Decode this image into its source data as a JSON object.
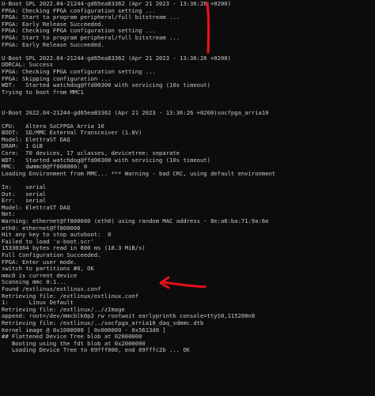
{
  "terminal": {
    "lines": [
      "U-Boot SPL 2022.04-21244-gd65ea83362 (Apr 21 2023 - 13:36:26 +0200)",
      "FPGA: Checking FPGA configuration setting ...",
      "FPGA: Start to program peripheral/full bitstream ...",
      "FPGA: Early Release Succeeded.",
      "FPGA: Checking FPGA configuration setting ...",
      "FPGA: Start to program peripheral/full bitstream ...",
      "FPGA: Early Release Succeeded.",
      "",
      "U-Boot SPL 2022.04-21244-gd65ea83362 (Apr 21 2023 - 13:36:26 +0200)",
      "DDRCAL: Success",
      "FPGA: Checking FPGA configuration setting ...",
      "FPGA: Skipping configuration ...",
      "WDT:   Started watchdog@ffd00300 with servicing (10s timeout)",
      "Trying to boot from MMC1",
      "",
      "",
      "U-Boot 2022.04-21244-gd65ea83362 (Apr 21 2023 - 13:36:26 +0200)socfpga_arria10",
      "",
      "CPU:   Altera SoCFPGA Arria 10",
      "BOOT:  SD/MMC External Transceiver (1.8V)",
      "Model: ElettraST DAQ",
      "DRAM:  1 GiB",
      "Core:  70 devices, 17 uclasses, devicetree: separate",
      "WDT:   Started watchdog@ffd00300 with servicing (10s timeout)",
      "MMC:   dwmmc0@ff808000: 0",
      "Loading Environment from MMC... *** Warning - bad CRC, using default environment",
      "",
      "In:    serial",
      "Out:   serial",
      "Err:   serial",
      "Model: ElettraST DAQ",
      "Net:",
      "Warning: ethernet@ff800000 (eth0) using random MAC address - 8e:a6:ba:71:9a:6e",
      "eth0: ethernet@ff800000",
      "Hit any key to stop autoboot:  0",
      "Failed to load 'u-boot.scr'",
      "15330364 bytes read in 800 ms (18.3 MiB/s)",
      "Full Configuration Succeeded.",
      "FPGA: Enter user mode.",
      "switch to partitions #0, OK",
      "mmc0 is current device",
      "Scanning mmc 0:1...",
      "Found /extlinux/extlinux.conf",
      "Retrieving file: /extlinux/extlinux.conf",
      "1:      Linux Default",
      "Retrieving file: /extlinux/../zImage",
      "append: root=/dev/mmcblk0p2 rw rootwait earlyprintk console=ttyS0,115200n8",
      "Retrieving file: /extlinux/../socfpga_arria10_daq_sdmmc.dtb",
      "Kernel image @ 0x1000000 [ 0x000000 - 0x5613d8 ]",
      "## Flattened Device Tree blob at 02000000",
      "   Booting using the fdt blob at 0x2000000",
      "   Loading Device Tree to 09fff000, end 09fffc2b ... OK"
    ]
  },
  "annotations": {
    "color": "#e8101a",
    "vertical_mark": "red-vertical-stroke",
    "arrow_mark": "red-arrow"
  }
}
